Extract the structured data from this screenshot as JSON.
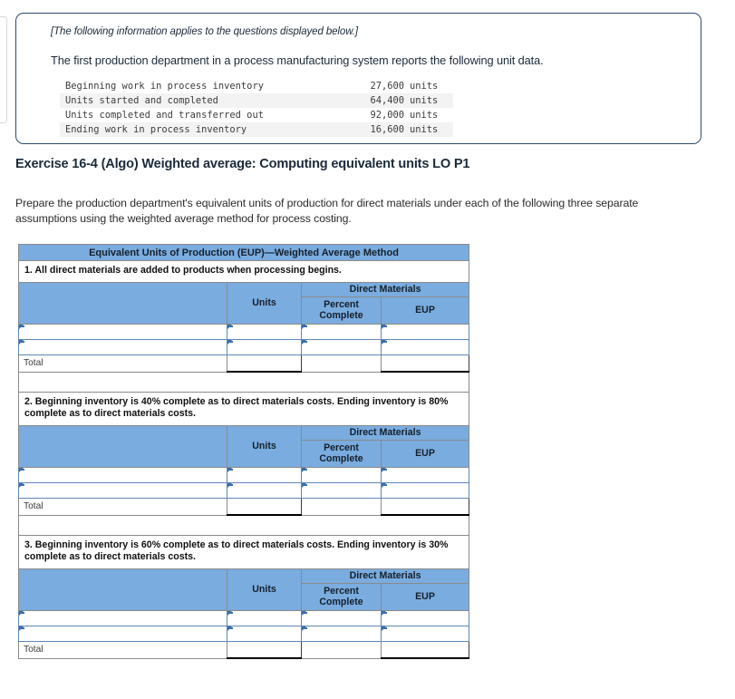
{
  "info_card": {
    "note": "[The following information applies to the questions displayed below.]",
    "lead": "The first production department in a process manufacturing system reports the following unit data.",
    "unit_rows": [
      {
        "label": "Beginning work in process inventory",
        "value": "27,600",
        "suffix": "units"
      },
      {
        "label": "Units started and completed",
        "value": "64,400",
        "suffix": "units"
      },
      {
        "label": "Units completed and transferred out",
        "value": "92,000",
        "suffix": "units"
      },
      {
        "label": "Ending work in process inventory",
        "value": "16,600",
        "suffix": "units"
      }
    ]
  },
  "exercise": {
    "title": "Exercise 16-4 (Algo) Weighted average: Computing equivalent units LO P1",
    "prompt": "Prepare the production department's equivalent units of production for direct materials under each of the following three separate assumptions using the weighted average method for process costing."
  },
  "worksheet": {
    "title": "Equivalent Units of Production (EUP)—Weighted Average Method",
    "columns": {
      "desc": "",
      "units": "Units",
      "group": "Direct Materials",
      "percent_complete": "Percent\nComplete",
      "percent_complete_line1": "Percent",
      "percent_complete_line2": "Complete",
      "eup": "EUP"
    },
    "total_label": "Total",
    "sections": [
      {
        "assumption": "1. All direct materials are added to products when processing begins.",
        "rows": [
          {
            "desc": "",
            "units": "",
            "percent": "",
            "eup": ""
          },
          {
            "desc": "",
            "units": "",
            "percent": "",
            "eup": ""
          }
        ],
        "total": {
          "units": "",
          "percent": "",
          "eup": ""
        }
      },
      {
        "assumption": "2. Beginning inventory is 40% complete as to direct materials costs. Ending inventory is 80% complete as to direct materials costs.",
        "rows": [
          {
            "desc": "",
            "units": "",
            "percent": "",
            "eup": ""
          },
          {
            "desc": "",
            "units": "",
            "percent": "",
            "eup": ""
          }
        ],
        "total": {
          "units": "",
          "percent": "",
          "eup": ""
        }
      },
      {
        "assumption": "3. Beginning inventory is 60% complete as to direct materials costs. Ending inventory is 30% complete as to direct materials costs.",
        "rows": [
          {
            "desc": "",
            "units": "",
            "percent": "",
            "eup": ""
          },
          {
            "desc": "",
            "units": "",
            "percent": "",
            "eup": ""
          }
        ],
        "total": {
          "units": "",
          "percent": "",
          "eup": ""
        }
      }
    ]
  },
  "colors": {
    "header_blue": "#7aacdf",
    "total_highlight": "#fdf6b7",
    "card_border": "#2b4a6f",
    "cell_border_blue": "#5e87b5"
  }
}
